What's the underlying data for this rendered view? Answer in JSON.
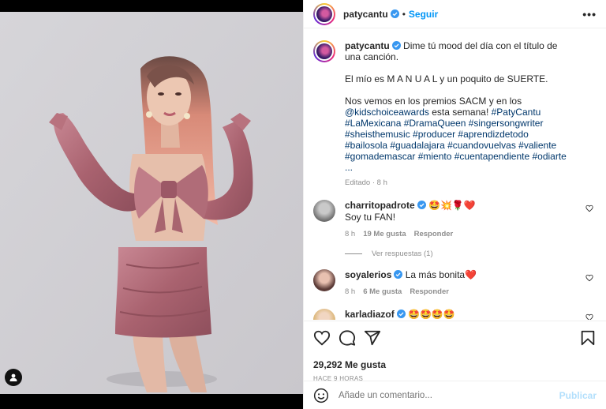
{
  "post": {
    "username": "patycantu",
    "follow_label": "Seguir",
    "more_label": "•••",
    "caption_user": "patycantu",
    "caption_line1": "Dime tú mood del día con el título de una canción.",
    "caption_line2": "El mío es M A N U A L y un poquito de SUERTE.",
    "caption_line3_start": "Nos vemos en los premios SACM y en los",
    "caption_mention": "@kidschoiceawards",
    "caption_line3_end": " esta semana! ",
    "hashtags": "#PatyCantu #LaMexicana #DramaQueen #singersongwriter #sheisthemusic #producer #aprendizdetodo #bailosola #guadalajara #cuandovuelvas #valiente #gomademascar #miento #cuentapendiente #odiarte ...",
    "caption_meta": "Editado · 8 h"
  },
  "comments": [
    {
      "user": "charritopadrote",
      "text": "🤩💥🌹❤️",
      "line2": "Soy tu FAN!",
      "time": "8 h",
      "likes": "19 Me gusta",
      "reply": "Responder"
    },
    {
      "user": "soyalerios",
      "text": "La más bonita❤️",
      "time": "8 h",
      "likes": "6 Me gusta",
      "reply": "Responder"
    },
    {
      "user": "karladiazof",
      "text": "🤩🤩🤩🤩"
    }
  ],
  "view_replies": "Ver respuestas (1)",
  "likes_count": "29,292 Me gusta",
  "posted_ago": "HACE 9 HORAS",
  "comment_input": {
    "placeholder": "Añade un comentario..."
  },
  "publish_label": "Publicar",
  "colors": {
    "link": "#0095f6",
    "mention": "#00376b",
    "dress": "#b86e7a",
    "background": "#d9d8dc"
  }
}
